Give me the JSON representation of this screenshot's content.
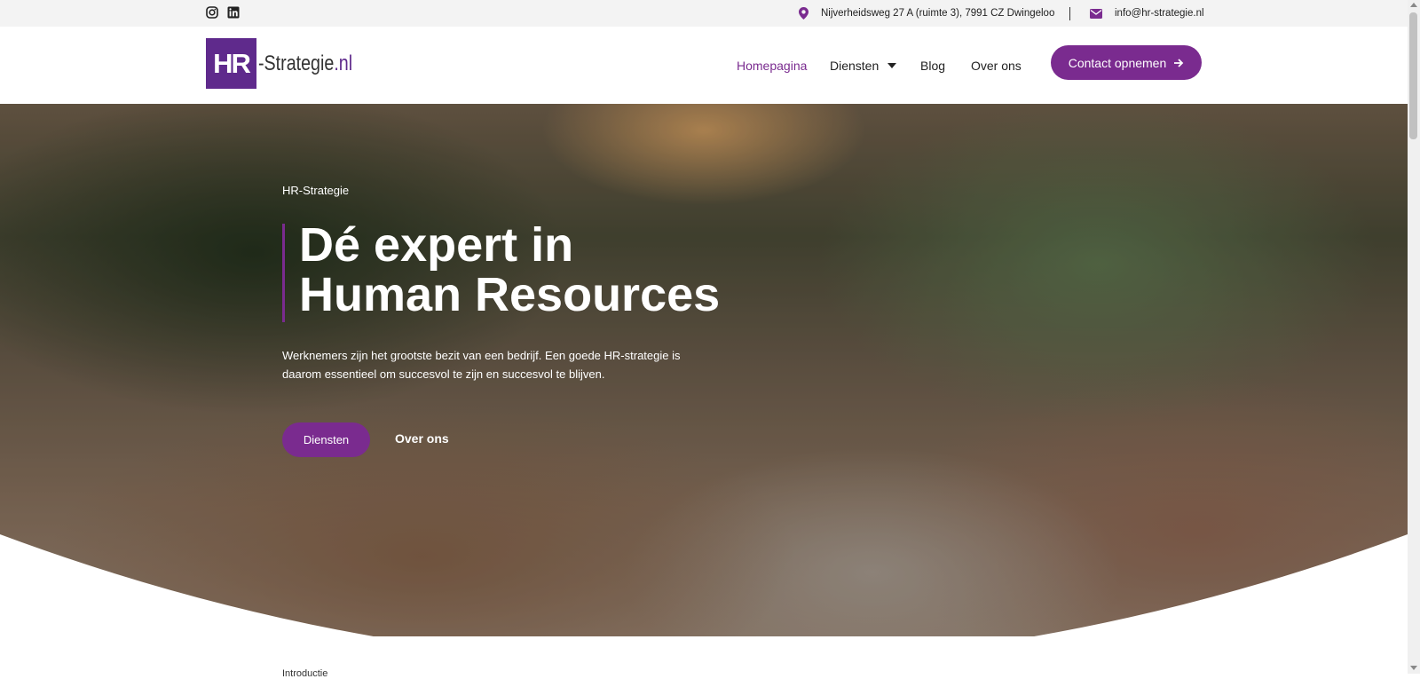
{
  "topbar": {
    "address": "Nijverheidsweg 27 A (ruimte 3), 7991 CZ Dwingeloo",
    "email": "info@hr-strategie.nl",
    "social": [
      "instagram-icon",
      "linkedin-icon"
    ]
  },
  "header": {
    "logo_mark": "HR",
    "logo_text": "-Strategie",
    "logo_suffix": ".nl",
    "nav": {
      "home": "Homepagina",
      "services": "Diensten",
      "blog": "Blog",
      "about": "Over ons"
    },
    "cta_label": "Contact opnemen"
  },
  "hero": {
    "eyebrow": "HR-Strategie",
    "title_line1": "Dé expert in",
    "title_line2": "Human Resources",
    "lead": "Werknemers zijn het grootste bezit van een bedrijf. Een goede HR-strategie is daarom essentieel om succesvol te zijn en succesvol te blijven.",
    "primary_button": "Diensten",
    "secondary_link": "Over ons"
  },
  "intro": {
    "eyebrow": "Introductie"
  },
  "colors": {
    "brand": "#7a2b8f",
    "logo": "#5f2a8c",
    "topbar_bg": "#f3f3f3"
  }
}
